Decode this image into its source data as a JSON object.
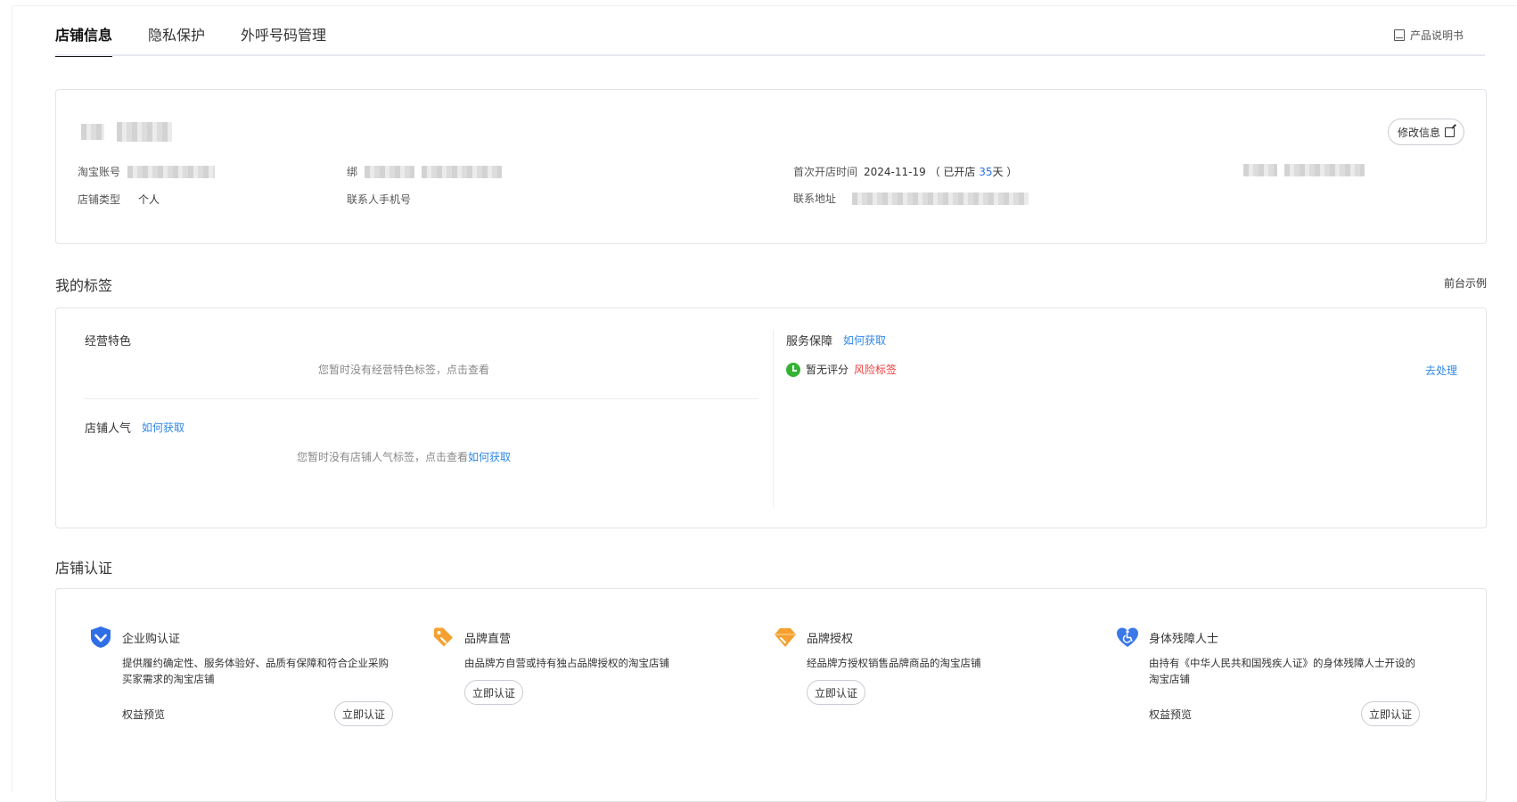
{
  "tabs": [
    {
      "label": "店铺信息",
      "active": true
    },
    {
      "label": "隐私保护",
      "active": false
    },
    {
      "label": "外呼号码管理",
      "active": false
    }
  ],
  "manual": {
    "label": "产品说明书",
    "icon": "book-icon"
  },
  "shop": {
    "edit_label": "修改信息",
    "taobao_account_label": "淘宝账号",
    "bind_label": "绑",
    "open_time_label": "首次开店时间",
    "open_date": "2024-11-19",
    "open_prefix": "（ 已开店 ",
    "open_days": "35",
    "open_suffix": "天 ）",
    "shop_type_label": "店铺类型",
    "shop_type": "个人",
    "contact_phone_label": "联系人手机号",
    "address_label": "联系地址"
  },
  "tags": {
    "title": "我的标签",
    "front_example": "前台示例",
    "business": {
      "title": "经营特色",
      "empty": "您暂时没有经营特色标签，点击查看"
    },
    "popularity": {
      "title": "店铺人气",
      "how": "如何获取",
      "empty": "您暂时没有店铺人气标签，点击查看",
      "empty_link": "如何获取"
    },
    "service": {
      "title": "服务保障",
      "how": "如何获取",
      "status": "暂无评分",
      "risk": "风险标签",
      "action": "去处理"
    }
  },
  "certification": {
    "title": "店铺认证",
    "items": [
      {
        "name": "企业购认证",
        "desc": "提供履约确定性、服务体验好、品质有保障和符合企业采购买家需求的淘宝店铺",
        "benefit": "权益预览",
        "button": "立即认证",
        "icon": "shield-check-icon",
        "color": "#2f6fe6"
      },
      {
        "name": "品牌直营",
        "desc": "由品牌方自营或持有独占品牌授权的淘宝店铺",
        "benefit": "",
        "button": "立即认证",
        "icon": "tag-icon",
        "color": "#f5a030"
      },
      {
        "name": "品牌授权",
        "desc": "经品牌方授权销售品牌商品的淘宝店铺",
        "benefit": "",
        "button": "立即认证",
        "icon": "diamond-icon",
        "color": "#f5a030"
      },
      {
        "name": "身体残障人士",
        "desc": "由持有《中华人民共和国残疾人证》的身体残障人士开设的淘宝店铺",
        "benefit": "权益预览",
        "button": "立即认证",
        "icon": "heart-accessibility-icon",
        "color": "#3a78ea"
      }
    ]
  }
}
